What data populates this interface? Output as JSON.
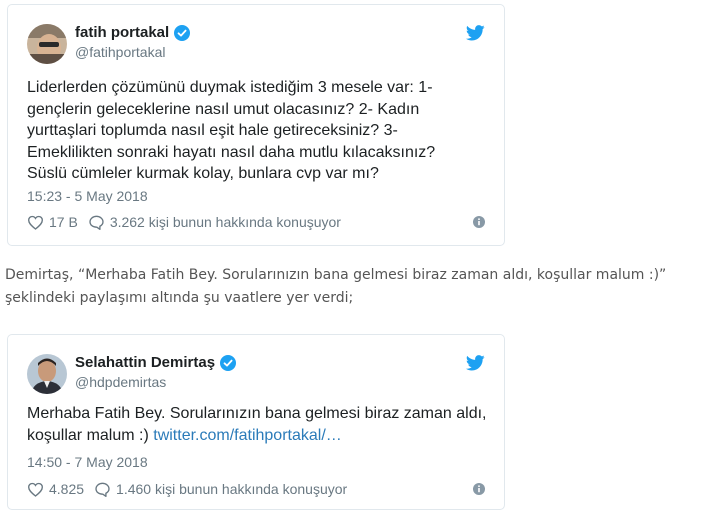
{
  "tweet1": {
    "display_name": "fatih portakal",
    "handle": "@fatihportakal",
    "text": "Liderlerden çözümünü duymak istediğim 3 mesele var: 1- gençlerin geleceklerine nasıl umut olacasınız? 2- Kadın yurttaşlari toplumda  nasıl eşit hale getireceksiniz? 3- Emeklilikten sonraki hayatı nasıl daha mutlu kılacaksınız? Süslü cümleler kurmak kolay, bunlara cvp var mı?",
    "timestamp": "15:23 - 5 May 2018",
    "likes": "17 B",
    "conversation": "3.262 kişi bunun hakkında konuşuyor"
  },
  "article_text": "Demirtaş, “Merhaba Fatih Bey. Sorularınızın bana gelmesi biraz zaman aldı, koşullar malum :)” şeklindeki paylaşımı altında şu vaatlere yer verdi;",
  "tweet2": {
    "display_name": "Selahattin Demirtaş",
    "handle": "@hdpdemirtas",
    "text": "Merhaba Fatih Bey. Sorularınızın bana gelmesi biraz zaman aldı, koşullar malum :) ",
    "link": "twitter.com/fatihportakal/…",
    "timestamp": "14:50 - 7 May 2018",
    "likes": "4.825",
    "conversation": "1.460 kişi bunun hakkında konuşuyor"
  },
  "colors": {
    "twitter_blue": "#1da1f2",
    "link": "#2b7bb9",
    "secondary_text": "#697882",
    "border": "#e1e8ed"
  },
  "icons": [
    "avatar",
    "verified-badge-icon",
    "twitter-bird-icon",
    "heart-icon",
    "speech-bubble-icon",
    "info-icon"
  ]
}
